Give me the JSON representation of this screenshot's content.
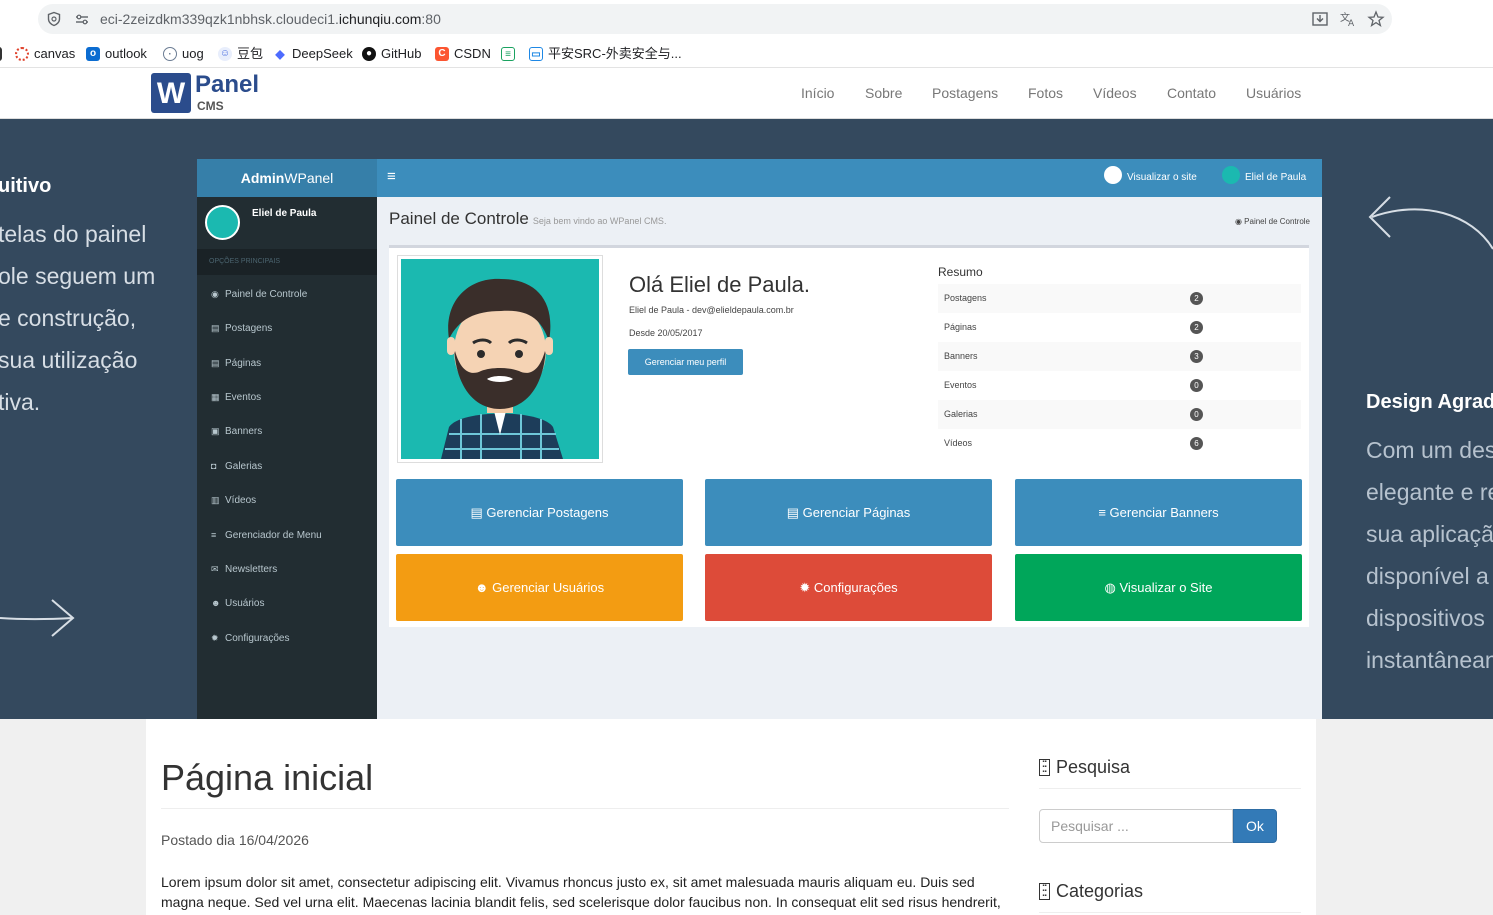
{
  "browser": {
    "url_prefix": "eci-2zeizdkm339qzk1nbhsk.cloudeci1.",
    "url_domain": "ichunqiu.com",
    "url_suffix": ":80",
    "bookmarks": [
      {
        "label": "canvas",
        "icon": "canvas-icon",
        "color": "#e0412b"
      },
      {
        "label": "outlook",
        "icon": "outlook-icon",
        "color": "#0b6cd1"
      },
      {
        "label": "uog",
        "icon": "globe-icon",
        "color": "#6b7c93"
      },
      {
        "label": "豆包",
        "icon": "doubao-icon",
        "color": "#4a6ee0"
      },
      {
        "label": "DeepSeek",
        "icon": "deepseek-icon",
        "color": "#4d6bfe"
      },
      {
        "label": "GitHub",
        "icon": "github-icon",
        "color": "#111111"
      },
      {
        "label": "CSDN",
        "icon": "csdn-icon",
        "color": "#fc5531"
      },
      {
        "label": "",
        "icon": "notes-icon",
        "color": "#1aa260"
      },
      {
        "label": "平安SRC-外卖安全与...",
        "icon": "tv-icon",
        "color": "#1e88e5"
      }
    ]
  },
  "nav": {
    "logo_letter": "W",
    "logo_panel": "Panel",
    "logo_cms": "CMS",
    "links": [
      "Início",
      "Sobre",
      "Postagens",
      "Fotos",
      "Vídeos",
      "Contato",
      "Usuários"
    ]
  },
  "hero": {
    "left_title": "uitivo",
    "left_lines": [
      "telas do painel",
      "ole seguem um",
      "e construção,",
      " sua utilização",
      "tiva."
    ],
    "right_title": "Design Agrad",
    "right_lines": [
      "Com um des",
      "elegante e re",
      "sua aplicaçã",
      "disponível a",
      "dispositivos",
      "instantânean"
    ]
  },
  "admin": {
    "logo_bold": "Admin",
    "logo_rest": "WPanel",
    "top_view_site": "Visualizar o site",
    "top_user": "Eliel de Paula",
    "side_user": "Eliel de Paula",
    "side_section": "OPÇÕES PRINCIPAIS",
    "menu": [
      {
        "label": "Painel de Controle",
        "icon": "dashboard-icon"
      },
      {
        "label": "Postagens",
        "icon": "posts-icon"
      },
      {
        "label": "Páginas",
        "icon": "pages-icon"
      },
      {
        "label": "Eventos",
        "icon": "calendar-icon"
      },
      {
        "label": "Banners",
        "icon": "banner-icon"
      },
      {
        "label": "Galerias",
        "icon": "camera-icon"
      },
      {
        "label": "Vídeos",
        "icon": "film-icon"
      },
      {
        "label": "Gerenciador de Menu",
        "icon": "menu-icon"
      },
      {
        "label": "Newsletters",
        "icon": "envelope-icon"
      },
      {
        "label": "Usuários",
        "icon": "users-icon"
      },
      {
        "label": "Configurações",
        "icon": "gear-icon"
      }
    ],
    "heading": "Painel de Controle",
    "heading_small": "Seja bem vindo ao WPanel CMS.",
    "breadcrumb": "Painel de Controle",
    "hello": "Olá Eliel de Paula.",
    "profile_email": "Eliel de Paula - dev@elieldepaula.com.br",
    "profile_since": "Desde 20/05/2017",
    "profile_button": "Gerenciar meu perfil",
    "resumo_title": "Resumo",
    "resumo": [
      {
        "label": "Postagens",
        "count": "2"
      },
      {
        "label": "Páginas",
        "count": "2"
      },
      {
        "label": "Banners",
        "count": "3"
      },
      {
        "label": "Eventos",
        "count": "0"
      },
      {
        "label": "Galerias",
        "count": "0"
      },
      {
        "label": "Vídeos",
        "count": "6"
      }
    ],
    "tiles": [
      {
        "label": "Gerenciar Postagens",
        "color": "#3c8dbc"
      },
      {
        "label": "Gerenciar Páginas",
        "color": "#3c8dbc"
      },
      {
        "label": "Gerenciar Banners",
        "color": "#3c8dbc"
      },
      {
        "label": "Gerenciar Usuários",
        "color": "#f39c12"
      },
      {
        "label": "Configurações",
        "color": "#dd4b39"
      },
      {
        "label": "Visualizar o Site",
        "color": "#00a65a"
      }
    ]
  },
  "content": {
    "title": "Página inicial",
    "posted": "Postado dia 16/04/2026",
    "body": "Lorem ipsum dolor sit amet, consectetur adipiscing elit. Vivamus rhoncus justo ex, sit amet malesuada mauris aliquam eu. Duis sed magna neque. Sed vel urna elit. Maecenas lacinia blandit felis, sed scelerisque dolor faucibus non. In consequat elit sed risus hendrerit,"
  },
  "sidebar": {
    "search_title": "Pesquisa",
    "search_placeholder": "Pesquisar ...",
    "search_button": "Ok",
    "categories_title": "Categorias"
  }
}
